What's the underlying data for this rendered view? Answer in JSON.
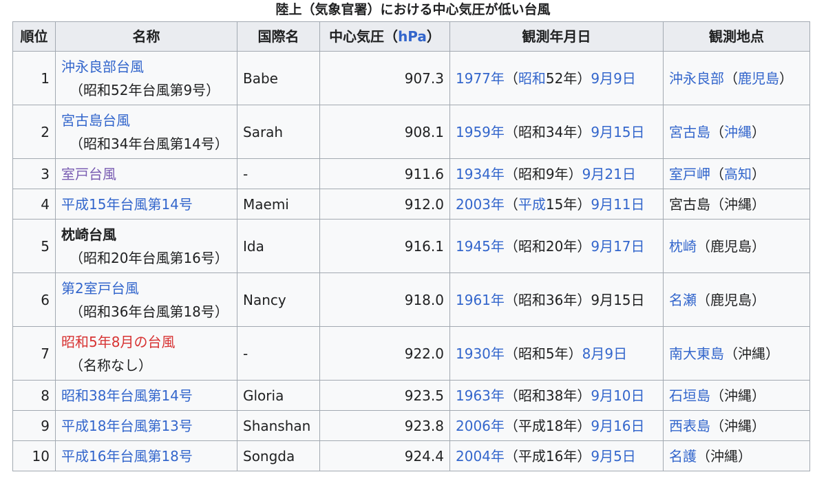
{
  "caption": "陸上（気象官署）における中心気圧が低い台風",
  "headers": {
    "rank": "順位",
    "name": "名称",
    "intl": "国際名",
    "pressure_prefix": "中心気圧（",
    "pressure_unit": "hPa",
    "pressure_suffix": "）",
    "date": "観測年月日",
    "place": "観測地点"
  },
  "rows": [
    {
      "rank": "1",
      "name": "沖永良部台風",
      "sub": "（昭和52年台風第9号）",
      "intl": "Babe",
      "pressure": "907.3",
      "year": "1977年",
      "era_open": "（",
      "era": "昭和",
      "era_rest": "52年）",
      "md": "9月9日",
      "place": "沖永良部",
      "place_p1": "（",
      "pref": "鹿児島",
      "place_p2": "）"
    },
    {
      "rank": "2",
      "name": "宮古島台風",
      "sub": "（昭和34年台風第14号）",
      "intl": "Sarah",
      "pressure": "908.1",
      "year": "1959年",
      "era_open": "（",
      "era": "昭和34年",
      "era_rest": "）",
      "md": "9月15日",
      "place": "宮古島",
      "place_p1": "（",
      "pref": "沖縄",
      "place_p2": "）"
    },
    {
      "rank": "3",
      "name": "室戸台風",
      "intl": "-",
      "pressure": "911.6",
      "year": "1934年",
      "era_open": "（",
      "era": "昭和9年",
      "era_rest": "）",
      "md": "9月21日",
      "place": "室戸岬",
      "place_p1": "（",
      "pref": "高知",
      "place_p2": "）"
    },
    {
      "rank": "4",
      "name": "平成15年台風第14号",
      "intl": "Maemi",
      "pressure": "912.0",
      "year": "2003年",
      "era_open": "（",
      "era": "平成",
      "era_rest": "15年）",
      "md": "9月11日",
      "place": "宮古島",
      "place_p1": "（",
      "pref": "沖縄",
      "place_p2": "）"
    },
    {
      "rank": "5",
      "name": "枕崎台風",
      "sub": "（昭和20年台風第16号）",
      "intl": "Ida",
      "pressure": "916.1",
      "year": "1945年",
      "era_open": "（",
      "era": "昭和20年",
      "era_rest": "）",
      "md": "9月17日",
      "place": "枕崎",
      "place_p1": "（",
      "pref": "鹿児島",
      "place_p2": "）"
    },
    {
      "rank": "6",
      "name": "第2室戸台風",
      "sub": "（昭和36年台風第18号）",
      "intl": "Nancy",
      "pressure": "918.0",
      "year": "1961年",
      "era_open": "（",
      "era": "昭和36年",
      "era_rest": "）",
      "md": "9月15日",
      "place": "名瀬",
      "place_p1": "（",
      "pref": "鹿児島",
      "place_p2": "）"
    },
    {
      "rank": "7",
      "name": "昭和5年8月の台風",
      "sub": "（名称なし）",
      "intl": "-",
      "pressure": "922.0",
      "year": "1930年",
      "era_open": "（",
      "era": "昭和5年",
      "era_rest": "）",
      "md": "8月9日",
      "place": "南大東島",
      "place_p1": "（",
      "pref": "沖縄",
      "place_p2": "）"
    },
    {
      "rank": "8",
      "name": "昭和38年台風第14号",
      "intl": "Gloria",
      "pressure": "923.5",
      "year": "1963年",
      "era_open": "（",
      "era": "昭和38年",
      "era_rest": "）",
      "md": "9月10日",
      "place": "石垣島",
      "place_p1": "（",
      "pref": "沖縄",
      "place_p2": "）"
    },
    {
      "rank": "9",
      "name": "平成18年台風第13号",
      "intl": "Shanshan",
      "pressure": "923.8",
      "year": "2006年",
      "era_open": "（",
      "era": "平成18年",
      "era_rest": "）",
      "md": "9月16日",
      "place": "西表島",
      "place_p1": "（",
      "pref": "沖縄",
      "place_p2": "）"
    },
    {
      "rank": "10",
      "name": "平成16年台風第18号",
      "intl": "Songda",
      "pressure": "924.4",
      "year": "2004年",
      "era_open": "（",
      "era": "平成16年",
      "era_rest": "）",
      "md": "9月5日",
      "place": "名護",
      "place_p1": "（",
      "pref": "沖縄",
      "place_p2": "）"
    }
  ]
}
